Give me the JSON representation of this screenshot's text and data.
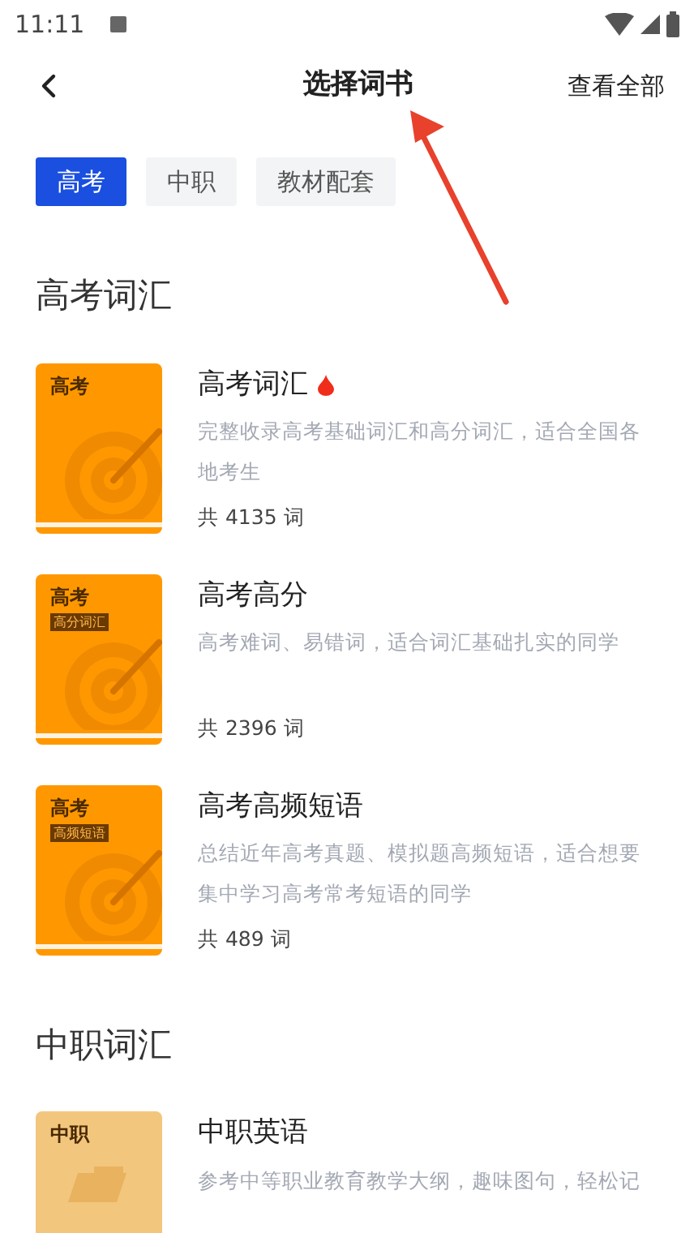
{
  "status_bar": {
    "time": "11:11"
  },
  "header": {
    "title": "选择词书",
    "action": "查看全部"
  },
  "tabs": [
    {
      "label": "高考",
      "selected": true
    },
    {
      "label": "中职",
      "selected": false
    },
    {
      "label": "教材配套",
      "selected": false
    }
  ],
  "sections": [
    {
      "title": "高考词汇",
      "books": [
        {
          "name": "高考词汇",
          "hot": true,
          "description": "完整收录高考基础词汇和高分词汇，适合全国各地考生",
          "count": "共 4135 词",
          "cover": {
            "kind": "target",
            "label": "高考"
          }
        },
        {
          "name": "高考高分",
          "hot": false,
          "description": "高考难词、易错词，适合词汇基础扎实的同学",
          "count": "共 2396 词",
          "cover": {
            "kind": "target",
            "label": "高考",
            "tag": "高分词汇"
          }
        },
        {
          "name": "高考高频短语",
          "hot": false,
          "description": "总结近年高考真题、模拟题高频短语，适合想要集中学习高考常考短语的同学",
          "count": "共 489 词",
          "cover": {
            "kind": "target",
            "label": "高考",
            "tag": "高频短语"
          }
        }
      ]
    },
    {
      "title": "中职词汇",
      "books": [
        {
          "name": "中职英语",
          "hot": false,
          "description": "参考中等职业教育教学大纲，趣味图句，轻松记",
          "cover": {
            "kind": "folder",
            "label": "中职"
          }
        }
      ]
    }
  ],
  "annotation": {
    "kind": "arrow"
  }
}
